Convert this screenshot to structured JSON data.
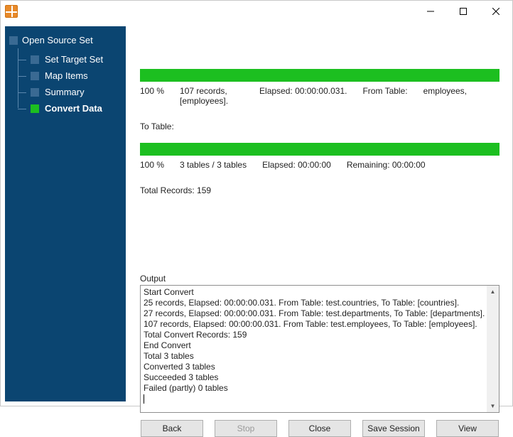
{
  "window": {
    "minimize_glyph": "—",
    "maximize_glyph": "▢",
    "close_glyph": "✕"
  },
  "sidebar": {
    "root": "Open Source Set",
    "items": [
      {
        "label": "Set Target Set",
        "active": false
      },
      {
        "label": "Map Items",
        "active": false
      },
      {
        "label": "Summary",
        "active": false
      },
      {
        "label": "Convert Data",
        "active": true
      }
    ]
  },
  "progress": {
    "table": {
      "percent": "100 %",
      "records": "107 records, [employees].",
      "elapsed": "Elapsed: 00:00:00.031.",
      "from": "From Table:",
      "from_val": "employees,",
      "to": "To Table:"
    },
    "total": {
      "percent": "100 %",
      "tables": "3 tables / 3 tables",
      "elapsed": "Elapsed: 00:00:00",
      "remaining": "Remaining: 00:00:00",
      "total": "Total Records: 159"
    }
  },
  "output": {
    "label": "Output",
    "lines": [
      "Start Convert",
      "25 records,    Elapsed: 00:00:00.031.    From Table: test.countries,    To Table: [countries].",
      "27 records,    Elapsed: 00:00:00.031.    From Table: test.departments,    To Table: [departments].",
      "107 records,    Elapsed: 00:00:00.031.    From Table: test.employees,    To Table: [employees].",
      "Total Convert Records: 159",
      "End Convert",
      "Total 3 tables",
      "Converted 3 tables",
      "Succeeded 3 tables",
      "Failed (partly) 0 tables"
    ]
  },
  "buttons": {
    "back": "Back",
    "stop": "Stop",
    "close": "Close",
    "save": "Save Session",
    "view": "View"
  }
}
